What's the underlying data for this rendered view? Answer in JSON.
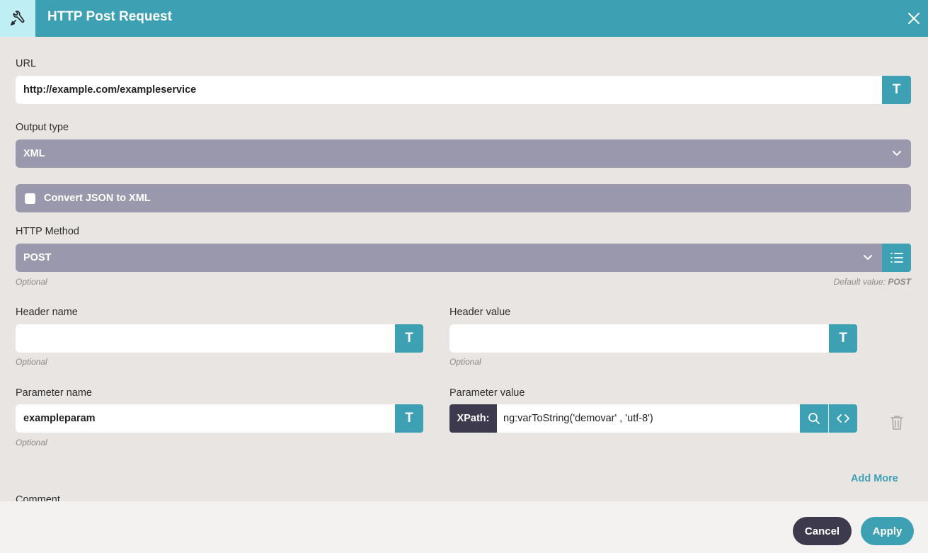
{
  "dialog": {
    "title": "HTTP Post Request",
    "header_icon": "tools-icon",
    "close_icon": "close-icon"
  },
  "url": {
    "label": "URL",
    "value": "http://example.com/exampleservice",
    "type_button": "T"
  },
  "output_type": {
    "label": "Output type",
    "selected": "XML"
  },
  "convert_json": {
    "label": "Convert JSON to XML",
    "checked": false
  },
  "http_method": {
    "label": "HTTP Method",
    "selected": "POST",
    "optional": "Optional",
    "default_prefix": "Default value:",
    "default_value": "POST"
  },
  "header_name": {
    "label": "Header name",
    "value": "",
    "type_button": "T",
    "optional": "Optional"
  },
  "header_value": {
    "label": "Header value",
    "value": "",
    "type_button": "T",
    "optional": "Optional"
  },
  "parameter_name": {
    "label": "Parameter name",
    "value": "exampleparam",
    "type_button": "T",
    "optional": "Optional"
  },
  "parameter_value": {
    "label": "Parameter value",
    "mode": "XPath:",
    "value": "ng:varToString('demovar' , 'utf-8')"
  },
  "add_more": "Add More",
  "comment": {
    "label": "Comment"
  },
  "footer": {
    "cancel": "Cancel",
    "apply": "Apply"
  },
  "colors": {
    "accent": "#3da1b3",
    "select_bg": "#9a98ad",
    "dark": "#3d3a4d",
    "background": "#e9e5e2"
  }
}
